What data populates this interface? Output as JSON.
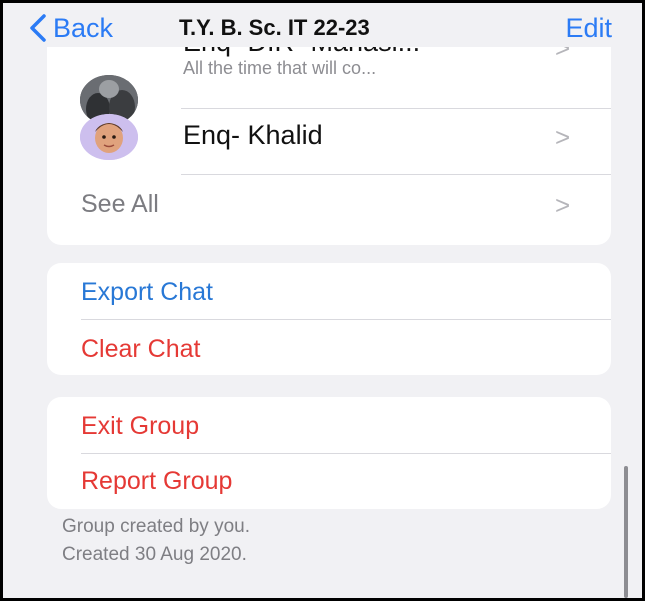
{
  "nav": {
    "back_label": "Back",
    "title": "T.Y. B. Sc. IT 22-23",
    "edit_label": "Edit"
  },
  "members": [
    {
      "name": "Enq- DIR- Manasi...",
      "subtitle": "All the time that will co..."
    },
    {
      "name": "Enq- Khalid",
      "subtitle": ""
    }
  ],
  "see_all_label": "See All",
  "chat_actions": {
    "export": "Export Chat",
    "clear": "Clear Chat"
  },
  "group_actions": {
    "exit": "Exit Group",
    "report": "Report Group"
  },
  "footer": {
    "line1": "Group created by you.",
    "line2": "Created 30 Aug 2020."
  },
  "colors": {
    "accent_blue": "#2b7bf5",
    "destructive_red": "#e53935",
    "background": "#f1f1f4"
  },
  "icons": [
    "chevron-left-icon",
    "chevron-right-icon",
    "avatar"
  ]
}
